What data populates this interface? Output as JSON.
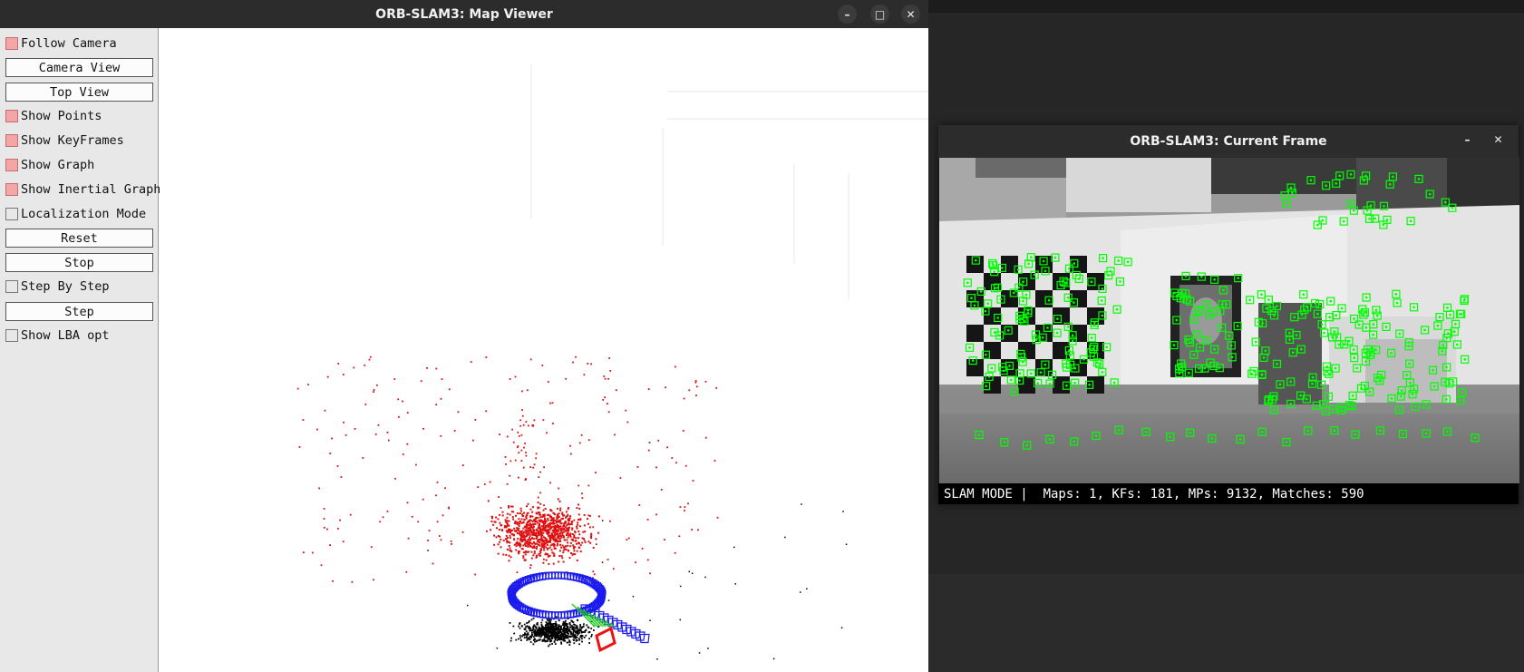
{
  "map_viewer": {
    "title": "ORB-SLAM3: Map Viewer",
    "window_buttons": {
      "minimize": "–",
      "maximize": "□",
      "close": "✕"
    },
    "controls": [
      {
        "kind": "checkbox",
        "label": "Follow Camera",
        "checked": true
      },
      {
        "kind": "button",
        "label": "Camera View"
      },
      {
        "kind": "button",
        "label": "Top View"
      },
      {
        "kind": "checkbox",
        "label": "Show Points",
        "checked": true
      },
      {
        "kind": "checkbox",
        "label": "Show KeyFrames",
        "checked": true
      },
      {
        "kind": "checkbox",
        "label": "Show Graph",
        "checked": true
      },
      {
        "kind": "checkbox",
        "label": "Show Inertial Graph",
        "checked": true
      },
      {
        "kind": "checkbox",
        "label": "Localization Mode",
        "checked": false
      },
      {
        "kind": "button",
        "label": "Reset"
      },
      {
        "kind": "button",
        "label": "Stop"
      },
      {
        "kind": "checkbox",
        "label": "Step By Step",
        "checked": false
      },
      {
        "kind": "button",
        "label": "Step"
      },
      {
        "kind": "checkbox",
        "label": "Show LBA opt",
        "checked": false
      }
    ],
    "colors": {
      "local_points": "#dd1111",
      "map_points": "#000000",
      "keyframes": "#1a1aee",
      "graph": "#22cc22",
      "current_camera": "#ee1111"
    }
  },
  "current_frame": {
    "title": "ORB-SLAM3: Current Frame",
    "window_buttons": {
      "minimize": "–",
      "close": "✕"
    },
    "status": "SLAM MODE |  Maps: 1, KFs: 181, MPs: 9132, Matches: 590",
    "feature_color": "#00ff00"
  }
}
